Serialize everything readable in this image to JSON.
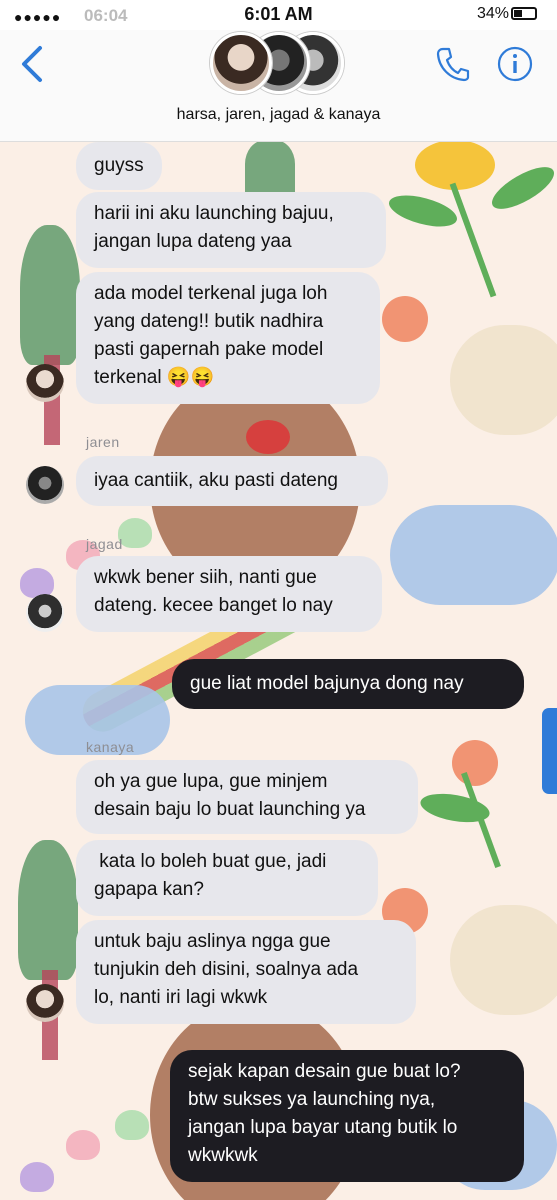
{
  "status_bar": {
    "signal": "●●●●●",
    "ghost_time": "06:04",
    "time": "6:01 AM",
    "battery": "34%"
  },
  "header": {
    "group_name": "harsa, jaren, jagad & kanaya"
  },
  "messages": [
    {
      "sender": "",
      "text": "guyss"
    },
    {
      "sender": "",
      "text": "harii ini aku launching bajuu,\njangan lupa dateng yaa"
    },
    {
      "sender": "",
      "text": "ada model terkenal juga loh\nyang dateng!! butik nadhira\npasti gapernah pake model\nterkenal 😝😝"
    },
    {
      "sender": "jaren",
      "text": "iyaa cantiik, aku pasti dateng"
    },
    {
      "sender": "jagad",
      "text": "wkwk bener siih, nanti gue\ndateng. kecee banget lo nay"
    },
    {
      "sender": "me",
      "text": "gue liat model bajunya dong nay"
    },
    {
      "sender": "kanaya",
      "text": "oh ya gue lupa, gue minjem\ndesain baju lo buat launching ya"
    },
    {
      "sender": "",
      "text": " kata lo boleh buat gue, jadi\ngapapa kan?"
    },
    {
      "sender": "",
      "text": "untuk baju aslinya ngga gue\ntunjukin deh disini, soalnya ada\nlo, nanti iri lagi wkwk"
    },
    {
      "sender": "me",
      "text": "sejak kapan desain gue buat lo?\nbtw sukses ya launching nya,\njangan lupa bayar utang butik lo\nwkwkwk"
    }
  ],
  "sender_labels": {
    "jaren": "jaren",
    "jagad": "jagad",
    "kanaya": "kanaya"
  },
  "colors": {
    "accent": "#2f7bd8",
    "incoming_bubble": "#e7e7ec",
    "outgoing_bubble": "#1d1c22",
    "wallpaper": "#fbefe6"
  },
  "icons": [
    "back-chevron-icon",
    "phone-icon",
    "info-icon"
  ]
}
